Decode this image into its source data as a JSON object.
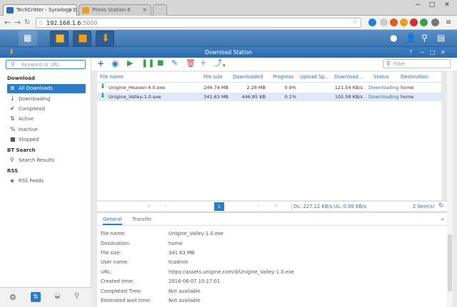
{
  "browser": {
    "tabs": [
      {
        "label": "TechCritter - Synology D",
        "active": true
      },
      {
        "label": "Photo Station 6",
        "active": false
      }
    ],
    "url_host": "192.168.1.6",
    "url_port": ":5000"
  },
  "app": {
    "title": "Download Station",
    "window_controls": [
      "?",
      "−",
      "□",
      "✕"
    ]
  },
  "sidebar": {
    "search_placeholder": "Keyword or URL",
    "sections": {
      "download": "Download",
      "bt_search": "BT Search",
      "rss": "RSS"
    },
    "items": [
      {
        "label": "All Downloads",
        "icon": "list-icon",
        "selected": true
      },
      {
        "label": "Downloading",
        "icon": "download-icon",
        "selected": false
      },
      {
        "label": "Completed",
        "icon": "check-icon",
        "selected": false
      },
      {
        "label": "Active",
        "icon": "updown-arrows-icon",
        "selected": false
      },
      {
        "label": "Inactive",
        "icon": "percent-icon",
        "selected": false
      },
      {
        "label": "Stopped",
        "icon": "stop-icon",
        "selected": false
      },
      {
        "label": "Search Results",
        "icon": "search-icon",
        "selected": false
      },
      {
        "label": "RSS Feeds",
        "icon": "rss-icon",
        "selected": false
      }
    ]
  },
  "toolbar": {
    "filter_placeholder": "Filter"
  },
  "grid": {
    "columns": [
      "File name",
      "File size",
      "Downloaded",
      "Progress",
      "Upload Sp...",
      "Download...",
      "Status",
      "Destination"
    ],
    "rows": [
      {
        "name": "Unigine_Heaven-4.0.exe",
        "size": "246.74 MB",
        "downloaded": "2.28 MB",
        "progress": "0.9%",
        "upload": "",
        "download": "121.54 KB/s",
        "status": "Downloading",
        "dest": "home",
        "selected": false
      },
      {
        "name": "Unigine_Valley-1.0.exe",
        "size": "341.63 MB",
        "downloaded": "446.85 KB",
        "progress": "0.1%",
        "upload": "",
        "download": "105.58 KB/s",
        "status": "Downloading",
        "dest": "home",
        "selected": true
      }
    ]
  },
  "pager": {
    "page": "1",
    "speed": "DL: 227.12 KB/s UL: 0.00 KB/s",
    "count": "2 item(s)"
  },
  "detail": {
    "tabs": [
      "General",
      "Transfer"
    ],
    "fields": [
      {
        "label": "File name:",
        "value": "Unigine_Valley-1.0.exe"
      },
      {
        "label": "Destination:",
        "value": "home"
      },
      {
        "label": "File size:",
        "value": "341.63 MB"
      },
      {
        "label": "User name:",
        "value": "tcadmin"
      },
      {
        "label": "URL:",
        "value": "https://assets.unigine.com/d/Unigine_Valley-1.0.exe"
      },
      {
        "label": "Created time:",
        "value": "2016-06-07 10:17:01"
      },
      {
        "label": "Completed Time:",
        "value": "Not available"
      },
      {
        "label": "Estimated wait time:",
        "value": "Not available"
      }
    ]
  },
  "colors": {
    "accent": "#2f7cc4",
    "download_green": "#2e9e3a",
    "header_blue": "#3f75b0"
  }
}
